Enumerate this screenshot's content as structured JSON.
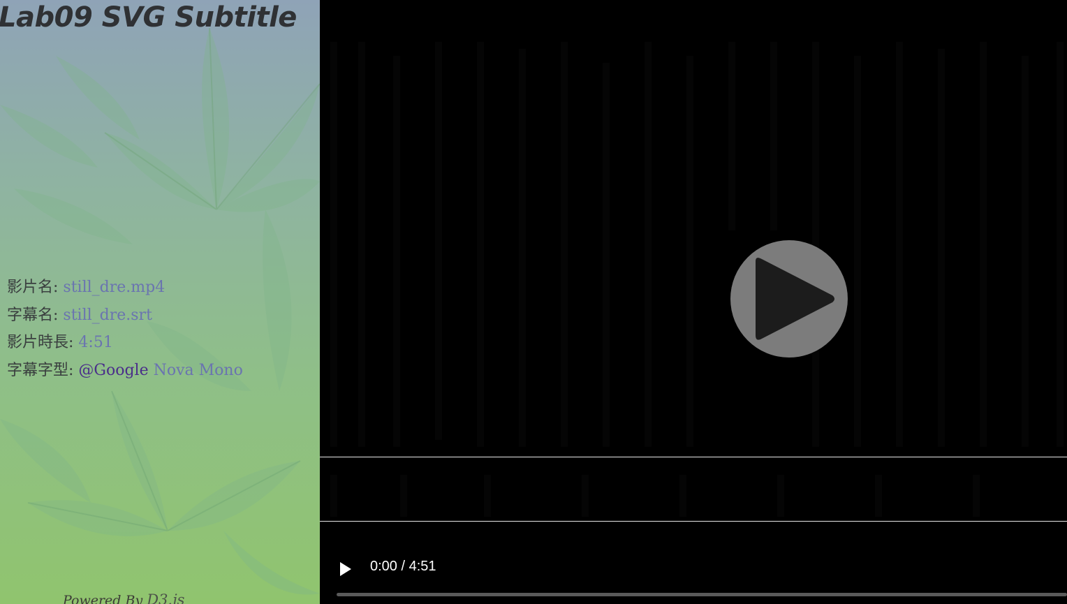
{
  "page": {
    "title": "Lab09 SVG Subtitle",
    "footer_prefix": "Powered By ",
    "footer_lib": "D3.js"
  },
  "info": {
    "video_label": "影片名: ",
    "video_value": "still_dre.mp4",
    "subtitle_label": "字幕名: ",
    "subtitle_value": "still_dre.srt",
    "duration_label": "影片時長: ",
    "duration_value": "4:51",
    "font_label": "字幕字型: ",
    "font_provider": "@Google",
    "font_name": " Nova Mono"
  },
  "player": {
    "subtitle_text": "",
    "current_time": "0:00",
    "time_separator": " / ",
    "duration": "4:51",
    "progress": 0,
    "state": "paused",
    "big_play_icon": "play-icon",
    "control_play_icon": "play-icon"
  },
  "colors": {
    "info_value": "#6a74b0",
    "subtitle_line": "#e8e8e8",
    "video_background": "#000000",
    "big_play_button": "#7c7c7c"
  }
}
